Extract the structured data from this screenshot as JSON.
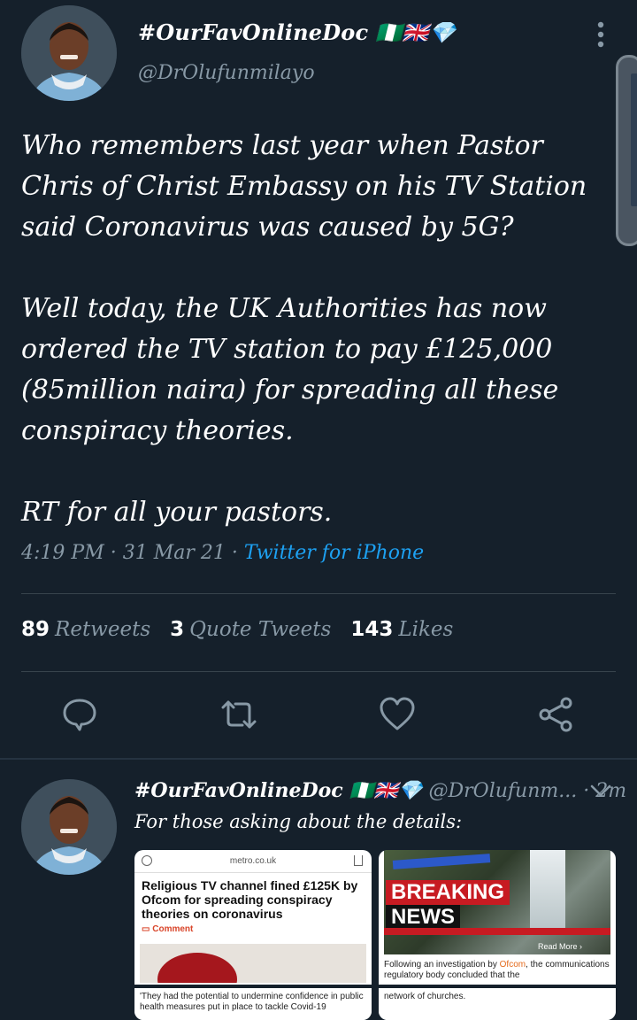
{
  "tweet": {
    "display_name": "#OurFavOnlineDoc 🇳🇬🇬🇧💎",
    "handle": "@DrOlufunmilayo",
    "body": "Who remembers last year when Pastor Chris of Christ Embassy on his TV Station said Coronavirus was caused by 5G?\n\nWell today, the UK Authorities has now ordered the TV station to pay £125,000 (85million naira) for spreading all these conspiracy theories.\n\nRT for all your pastors.",
    "time": "4:19 PM · 31 Mar 21 · ",
    "source": "Twitter for iPhone",
    "stats": {
      "retweets_count": "89",
      "retweets_label": "Retweets",
      "quotes_count": "3",
      "quotes_label": "Quote Tweets",
      "likes_count": "143",
      "likes_label": "Likes"
    },
    "actions": {
      "icons": [
        "reply-icon",
        "retweet-icon",
        "like-icon",
        "share-icon"
      ]
    }
  },
  "reply": {
    "display_name": "#OurFavOnlineDoc 🇳🇬🇬🇧💎",
    "handle": "@DrOlufunm...",
    "time": " · 2m",
    "text": "For those asking about the details:",
    "media": [
      {
        "url": "metro.co.uk",
        "headline": "Religious TV channel fined £125K by Ofcom for spreading conspiracy theories on coronavirus",
        "comment": "Comment",
        "caption": "'They had the potential to undermine confidence in public health measures put in place to tackle Covid-19"
      },
      {
        "breaking": "BREAKING",
        "news": "NEWS",
        "read_more": "Read More ›",
        "caption_pre": "Following an investigation by ",
        "caption_hl": "Ofcom",
        "caption_post": ", the communications regulatory body concluded that the",
        "caption2": "network of churches."
      }
    ]
  },
  "colors": {
    "background": "#15202b",
    "accent": "#1da1f2",
    "muted": "#8899a6",
    "divider": "#38444d"
  }
}
